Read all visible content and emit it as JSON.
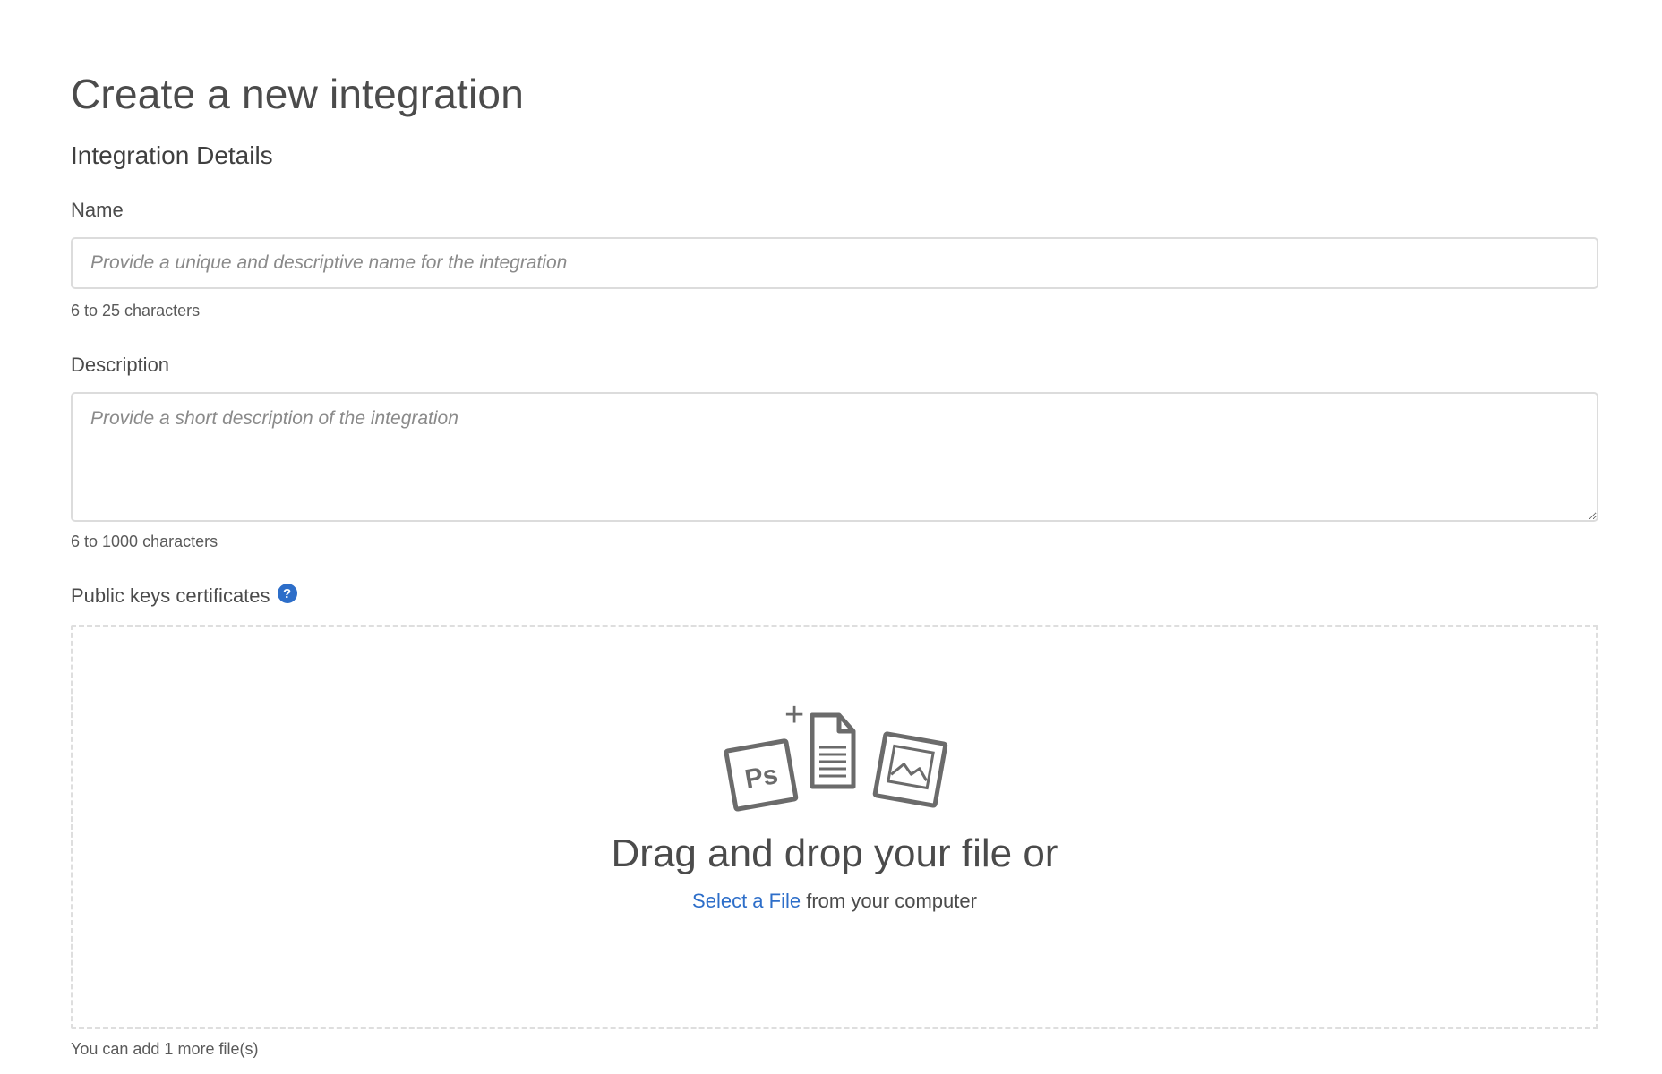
{
  "page": {
    "title": "Create a new integration",
    "section_title": "Integration Details"
  },
  "name_field": {
    "label": "Name",
    "placeholder": "Provide a unique and descriptive name for the integration",
    "value": "",
    "hint": "6 to 25 characters"
  },
  "description_field": {
    "label": "Description",
    "placeholder": "Provide a short description of the integration",
    "value": "",
    "hint": "6 to 1000 characters"
  },
  "public_keys": {
    "label": "Public keys certificates",
    "help_icon": "question-circle-icon",
    "help_glyph": "?",
    "dropzone": {
      "title": "Drag and drop your file or",
      "select_link": "Select a File",
      "select_suffix": " from your computer",
      "illustration_badge": "Ps",
      "illustration_plus": "+",
      "icons": [
        "photoshop-file-icon",
        "document-add-icon",
        "image-file-icon"
      ]
    },
    "hint": "You can add 1 more file(s)"
  },
  "colors": {
    "accent": "#2d6ec9",
    "border": "#dcdcdc",
    "dashed_border": "#dedede",
    "icon_gray": "#6b6b6b"
  }
}
